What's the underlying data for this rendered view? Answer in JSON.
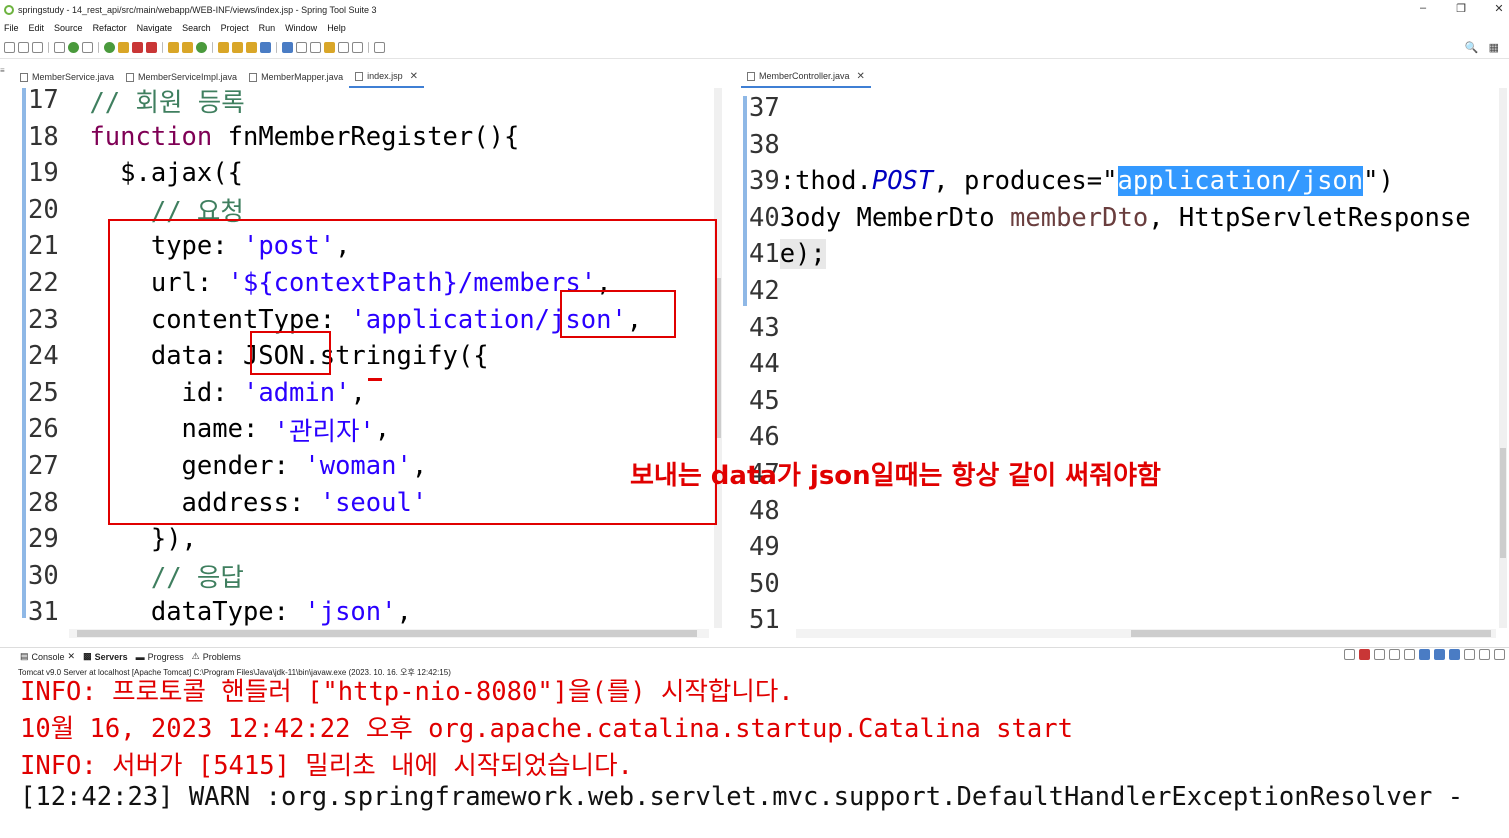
{
  "window": {
    "title": "springstudy - 14_rest_api/src/main/webapp/WEB-INF/views/index.jsp - Spring Tool Suite 3",
    "controls": [
      "–",
      "❐",
      "✕"
    ]
  },
  "menu": [
    "File",
    "Edit",
    "Source",
    "Refactor",
    "Navigate",
    "Search",
    "Project",
    "Run",
    "Window",
    "Help"
  ],
  "left_editor": {
    "tabs": [
      {
        "label": "MemberService.java",
        "active": false
      },
      {
        "label": "MemberServiceImpl.java",
        "active": false
      },
      {
        "label": "MemberMapper.java",
        "active": false
      },
      {
        "label": "index.jsp",
        "active": true,
        "close": "✕"
      }
    ],
    "lines": [
      {
        "n": "17",
        "indent": "  ",
        "parts": [
          [
            "cmt",
            "// 회원 등록"
          ]
        ]
      },
      {
        "n": "18",
        "indent": "  ",
        "parts": [
          [
            "kw",
            "function"
          ],
          [
            "",
            " fnMemberRegister(){"
          ]
        ]
      },
      {
        "n": "19",
        "indent": "    ",
        "parts": [
          [
            "",
            "$.ajax({"
          ]
        ]
      },
      {
        "n": "20",
        "indent": "      ",
        "parts": [
          [
            "cmt",
            "// 요청"
          ]
        ]
      },
      {
        "n": "21",
        "indent": "      ",
        "parts": [
          [
            "",
            "type: "
          ],
          [
            "str",
            "'post'"
          ],
          [
            "",
            ","
          ]
        ]
      },
      {
        "n": "22",
        "indent": "      ",
        "parts": [
          [
            "",
            "url: "
          ],
          [
            "str",
            "'${contextPath}/members'"
          ],
          [
            "",
            ","
          ]
        ]
      },
      {
        "n": "23",
        "indent": "      ",
        "parts": [
          [
            "",
            "contentType: "
          ],
          [
            "str",
            "'application/json'"
          ],
          [
            "",
            ","
          ]
        ]
      },
      {
        "n": "24",
        "indent": "      ",
        "parts": [
          [
            "",
            "data: JSON.stringify({"
          ]
        ]
      },
      {
        "n": "25",
        "indent": "        ",
        "parts": [
          [
            "",
            "id: "
          ],
          [
            "str",
            "'admin'"
          ],
          [
            "",
            ","
          ]
        ]
      },
      {
        "n": "26",
        "indent": "        ",
        "parts": [
          [
            "",
            "name: "
          ],
          [
            "str",
            "'관리자'"
          ],
          [
            "",
            ","
          ]
        ]
      },
      {
        "n": "27",
        "indent": "        ",
        "parts": [
          [
            "",
            "gender: "
          ],
          [
            "str",
            "'woman'"
          ],
          [
            "",
            ","
          ]
        ]
      },
      {
        "n": "28",
        "indent": "        ",
        "parts": [
          [
            "",
            "address: "
          ],
          [
            "str",
            "'seoul'"
          ]
        ]
      },
      {
        "n": "29",
        "indent": "      ",
        "parts": [
          [
            "",
            "}),"
          ]
        ]
      },
      {
        "n": "30",
        "indent": "      ",
        "parts": [
          [
            "cmt",
            "// 응답"
          ]
        ]
      },
      {
        "n": "31",
        "indent": "      ",
        "parts": [
          [
            "",
            "dataType: "
          ],
          [
            "str",
            "'json'"
          ],
          [
            "",
            ","
          ]
        ]
      }
    ]
  },
  "right_editor": {
    "tabs": [
      {
        "label": "MemberController.java",
        "active": true,
        "close": "✕"
      }
    ],
    "lines": [
      {
        "n": "37",
        "parts": []
      },
      {
        "n": "38",
        "parts": []
      },
      {
        "n": "39",
        "parts": [
          [
            "",
            ":thod."
          ],
          [
            "it",
            "POST"
          ],
          [
            "",
            ", produces=\""
          ],
          [
            "sel",
            "application/json"
          ],
          [
            "",
            "\")"
          ]
        ]
      },
      {
        "n": "40",
        "parts": [
          [
            "",
            "3ody MemberDto "
          ],
          [
            "kw2",
            "memberDto"
          ],
          [
            "",
            ", HttpServletResponse"
          ]
        ]
      },
      {
        "n": "41",
        "parts": [
          [
            "hl",
            "e);"
          ]
        ]
      },
      {
        "n": "42",
        "parts": []
      },
      {
        "n": "43",
        "parts": []
      },
      {
        "n": "44",
        "parts": []
      },
      {
        "n": "45",
        "parts": []
      },
      {
        "n": "46",
        "parts": []
      },
      {
        "n": "47",
        "parts": []
      },
      {
        "n": "48",
        "parts": []
      },
      {
        "n": "49",
        "parts": []
      },
      {
        "n": "50",
        "parts": []
      },
      {
        "n": "51",
        "parts": []
      }
    ]
  },
  "annotation": "보내는 data가 json일때는 항상 같이 써줘야함",
  "console": {
    "tabs": [
      {
        "label": "Console",
        "close": "✕",
        "bold": false
      },
      {
        "label": "Servers",
        "bold": true
      },
      {
        "label": "Progress",
        "bold": false
      },
      {
        "label": "Problems",
        "bold": false
      }
    ],
    "description": "Tomcat v9.0 Server at localhost [Apache Tomcat] C:\\Program Files\\Java\\jdk-11\\bin\\javaw.exe  (2023. 10. 16. 오후 12:42:15)",
    "lines": [
      {
        "text": "INFO: 프로토콜 핸들러 [\"http-nio-8080\"]을(를) 시작합니다.",
        "color": "red"
      },
      {
        "text": "10월 16, 2023 12:42:22 오후 org.apache.catalina.startup.Catalina start",
        "color": "red"
      },
      {
        "text": "INFO: 서버가 [5415] 밀리초 내에 시작되었습니다.",
        "color": "red"
      },
      {
        "text": "[12:42:23] WARN :org.springframework.web.servlet.mvc.support.DefaultHandlerExceptionResolver -",
        "color": "black"
      }
    ]
  },
  "colors": {
    "keyword": "#7f0055",
    "string": "#2a00ff",
    "comment": "#3f7f5f",
    "selection": "#3399ff",
    "annotation": "#e00000"
  }
}
